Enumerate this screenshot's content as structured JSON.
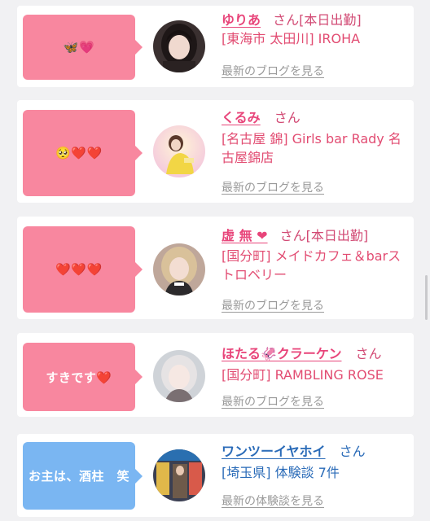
{
  "cards": [
    {
      "bubble": "🦋💗",
      "bubble_color": "#f8879f",
      "name": "ゆりあ",
      "suffix": "さん[本日出勤]",
      "location": "[東海市 太田川] IROHA",
      "link": "最新のブログを見る",
      "avatar": "portrait-dark-hair"
    },
    {
      "bubble": "🥺❤️❤️",
      "bubble_color": "#f8879f",
      "name": "くるみ",
      "suffix": "さん",
      "location": "[名古屋 錦] Girls bar Rady 名古屋錦店",
      "link": "最新のブログを見る",
      "avatar": "portrait-yellow-outfit"
    },
    {
      "bubble": "❤️❤️❤️",
      "bubble_color": "#f8879f",
      "name": "虚 無 ❤",
      "suffix": "さん[本日出勤]",
      "location": "[国分町] メイドカフェ＆barストロベリー",
      "link": "最新のブログを見る",
      "avatar": "portrait-blonde"
    },
    {
      "bubble": "すきです❤️",
      "bubble_color": "#f8879f",
      "name": "ほたる🦑クラーケン",
      "suffix": "さん",
      "location": "[国分町] RAMBLING ROSE",
      "link": "最新のブログを見る",
      "avatar": "portrait-light-hair"
    },
    {
      "bubble": "お主は、酒柱　笑",
      "bubble_color": "#7ab6f2",
      "name": "ワンツーイヤホイ",
      "suffix": "さん",
      "location": "[埼玉県] 体験談 7件",
      "link": "最新の体験談を見る",
      "avatar": "photo-shop-front"
    }
  ]
}
